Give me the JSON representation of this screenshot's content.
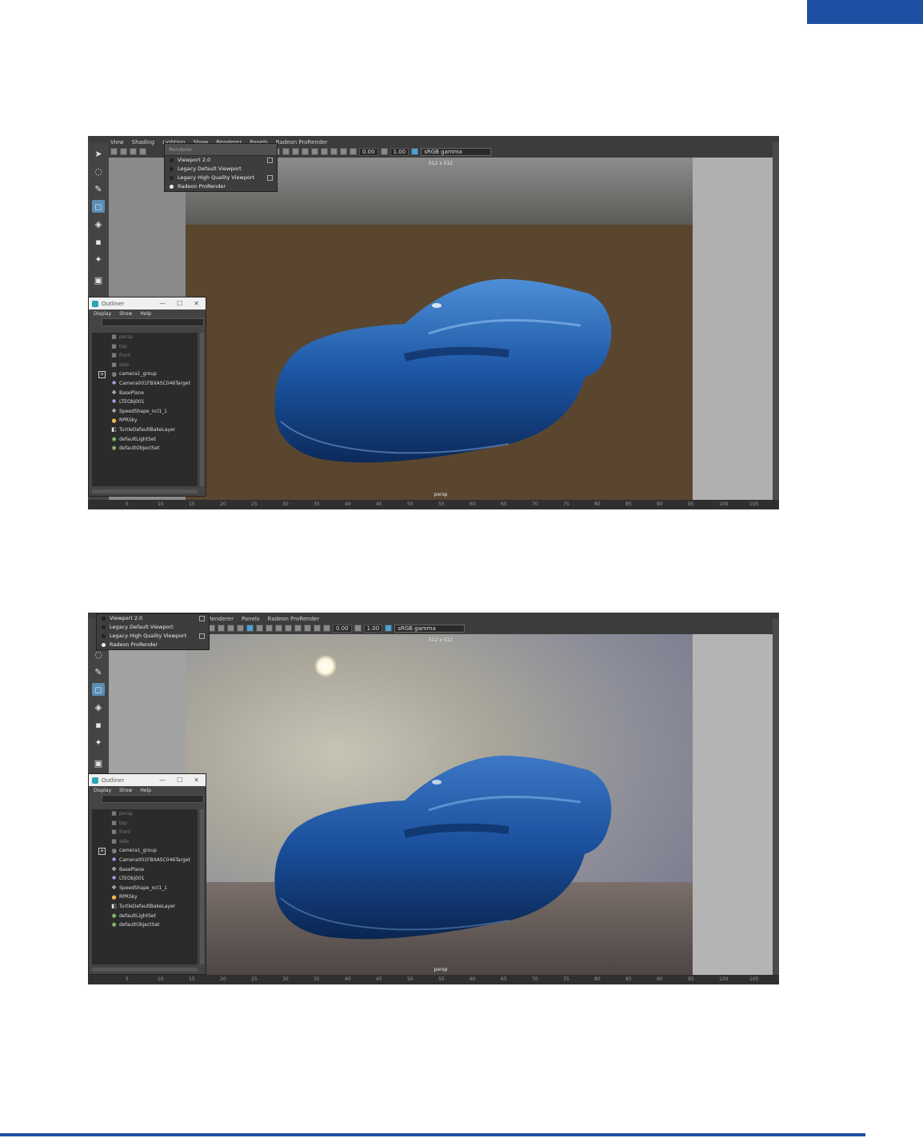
{
  "colors": {
    "accent": "#1f4fa3",
    "car_blue": "#1a4f9c",
    "selected_tool": "#5a8fb6"
  },
  "screenshots": [
    {
      "menubar": [
        "View",
        "Shading",
        "Lighting",
        "Show",
        "Renderer",
        "Panels",
        "Radeon ProRender"
      ],
      "exposure": "0.00",
      "gamma_value": "1.00",
      "color_space": "sRGB gamma",
      "resolution": "512 x 512",
      "camera": "persp",
      "renderer_menu": {
        "header": "Renderer",
        "items": [
          {
            "label": "Viewport 2.0",
            "selected": false,
            "option_box": true
          },
          {
            "label": "Legacy Default Viewport",
            "selected": false,
            "option_box": false
          },
          {
            "label": "Legacy High Quality Viewport",
            "selected": false,
            "option_box": true
          },
          {
            "label": "Radeon ProRender",
            "selected": true,
            "option_box": false
          }
        ]
      },
      "outliner": {
        "title": "Outliner",
        "menu": [
          "Display",
          "Show",
          "Help"
        ],
        "items": [
          {
            "label": "persp",
            "icon": "camera-icon",
            "dim": true
          },
          {
            "label": "top",
            "icon": "camera-icon",
            "dim": true
          },
          {
            "label": "front",
            "icon": "camera-icon",
            "dim": true
          },
          {
            "label": "side",
            "icon": "camera-icon",
            "dim": true
          },
          {
            "label": "camera1_group",
            "icon": "group-icon",
            "dim": false,
            "expand": true
          },
          {
            "label": "Camera001FBXASC046Target",
            "icon": "star-icon",
            "dim": false
          },
          {
            "label": "BasePlane",
            "icon": "mesh-icon",
            "dim": false
          },
          {
            "label": "LTEObj001",
            "icon": "star-icon",
            "dim": false
          },
          {
            "label": "SpeedShape_ncl1_1",
            "icon": "mesh-icon",
            "dim": false
          },
          {
            "label": "RPRSky",
            "icon": "sky-icon",
            "dim": false
          },
          {
            "label": "TurtleDefaultBakeLayer",
            "icon": "layer-icon",
            "dim": false
          },
          {
            "label": "defaultLightSet",
            "icon": "set-icon",
            "dim": false
          },
          {
            "label": "defaultObjectSet",
            "icon": "set-icon",
            "dim": false
          }
        ]
      },
      "timeline_ticks": [
        "5",
        "10",
        "15",
        "20",
        "25",
        "30",
        "35",
        "40",
        "45",
        "50",
        "55",
        "60",
        "65",
        "70",
        "75",
        "80",
        "85",
        "90",
        "95",
        "100",
        "105"
      ]
    },
    {
      "menubar": [
        "Renderer",
        "Panels",
        "Radeon ProRender"
      ],
      "exposure": "0.00",
      "gamma_value": "1.00",
      "color_space": "sRGB gamma",
      "resolution": "512 x 512",
      "camera": "persp",
      "renderer_menu": {
        "header": "",
        "items": [
          {
            "label": "Viewport 2.0",
            "selected": false,
            "option_box": true
          },
          {
            "label": "Legacy Default Viewport",
            "selected": false,
            "option_box": false
          },
          {
            "label": "Legacy High Quality Viewport",
            "selected": false,
            "option_box": true
          },
          {
            "label": "Radeon ProRender",
            "selected": true,
            "option_box": false
          }
        ]
      },
      "outliner": {
        "title": "Outliner",
        "menu": [
          "Display",
          "Show",
          "Help"
        ],
        "items": [
          {
            "label": "persp",
            "icon": "camera-icon",
            "dim": true
          },
          {
            "label": "top",
            "icon": "camera-icon",
            "dim": true
          },
          {
            "label": "front",
            "icon": "camera-icon",
            "dim": true
          },
          {
            "label": "side",
            "icon": "camera-icon",
            "dim": true
          },
          {
            "label": "camera1_group",
            "icon": "group-icon",
            "dim": false,
            "expand": true
          },
          {
            "label": "Camera001FBXASC046Target",
            "icon": "star-icon",
            "dim": false
          },
          {
            "label": "BasePlane",
            "icon": "mesh-icon",
            "dim": false
          },
          {
            "label": "LTEObj001",
            "icon": "star-icon",
            "dim": false
          },
          {
            "label": "SpeedShape_ncl1_1",
            "icon": "mesh-icon",
            "dim": false
          },
          {
            "label": "RPRSky",
            "icon": "sky-icon",
            "dim": false
          },
          {
            "label": "TurtleDefaultBakeLayer",
            "icon": "layer-icon",
            "dim": false
          },
          {
            "label": "defaultLightSet",
            "icon": "set-icon",
            "dim": false
          },
          {
            "label": "defaultObjectSet",
            "icon": "set-icon",
            "dim": false
          }
        ]
      },
      "timeline_ticks": [
        "5",
        "10",
        "15",
        "20",
        "25",
        "30",
        "35",
        "40",
        "45",
        "50",
        "55",
        "60",
        "65",
        "70",
        "75",
        "80",
        "85",
        "90",
        "95",
        "100",
        "105"
      ]
    }
  ]
}
